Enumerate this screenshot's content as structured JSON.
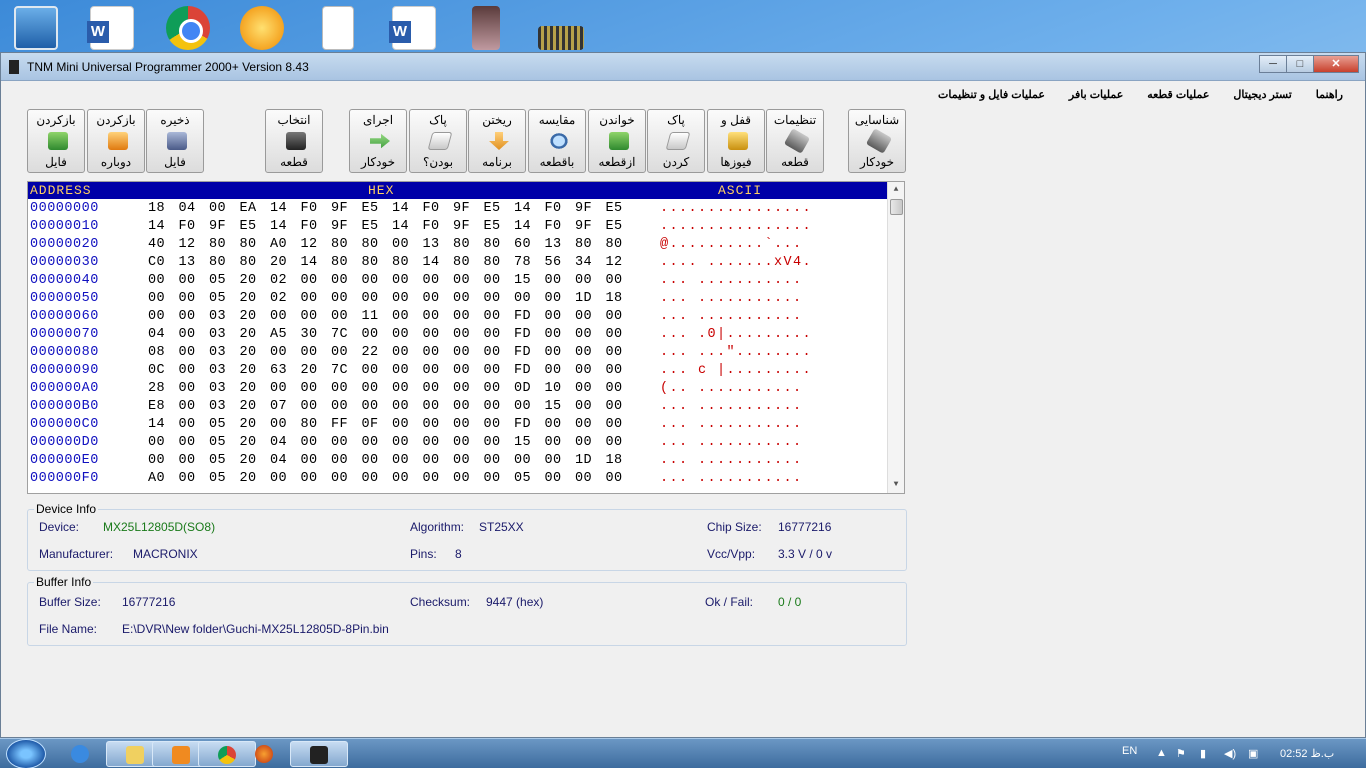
{
  "window": {
    "title": "TNM Mini Universal Programmer 2000+    Version 8.43",
    "controls": {
      "minimize": "─",
      "maximize": "□",
      "close": "✕"
    }
  },
  "menu": [
    "عملیات فایل و تنظیمات",
    "عملیات بافر",
    "عملیات قطعه",
    "تستر دیجیتال",
    "راهنما"
  ],
  "toolbar": {
    "reload_file": {
      "line1": "بازکردن",
      "line2": "فایل",
      "icon": "open-folder-icon"
    },
    "reopen": {
      "line1": "بازکردن",
      "line2": "دوباره",
      "icon": "reload-icon"
    },
    "save_file": {
      "line1": "ذخیره",
      "line2": "فایل",
      "icon": "save-disk-icon"
    },
    "select_chip": {
      "line1": "انتخاب",
      "line2": "قطعه",
      "icon": "chip-select-icon"
    },
    "auto_run": {
      "line1": "اجرای",
      "line2": "خودکار",
      "icon": "auto-arrow-icon"
    },
    "blank_check": {
      "line1": "پاک",
      "line2": "بودن؟",
      "icon": "eraser-icon"
    },
    "write": {
      "line1": "ریختن",
      "line2": "برنامه",
      "icon": "write-down-icon"
    },
    "verify": {
      "line1": "مقایسه",
      "line2": "باقطعه",
      "icon": "magnify-icon"
    },
    "read": {
      "line1": "خواندن",
      "line2": "ازقطعه",
      "icon": "read-chip-icon"
    },
    "erase": {
      "line1": "پاک",
      "line2": "کردن",
      "icon": "erase-icon"
    },
    "lock_fuses": {
      "line1": "قفل و",
      "line2": "فیوزها",
      "icon": "lock-icon"
    },
    "chip_settings": {
      "line1": "تنظیمات",
      "line2": "قطعه",
      "icon": "tools-icon"
    },
    "auto_detect": {
      "line1": "شناسایی",
      "line2": "خودکار",
      "icon": "auto-detect-icon"
    }
  },
  "hex": {
    "headers": {
      "address": "ADDRESS",
      "hex": "HEX",
      "ascii": "ASCII"
    },
    "rows": [
      {
        "addr": "00000000",
        "bytes": "18 04 00 EA 14 F0 9F E5 14 F0 9F E5 14 F0 9F E5",
        "ascii": "................"
      },
      {
        "addr": "00000010",
        "bytes": "14 F0 9F E5 14 F0 9F E5 14 F0 9F E5 14 F0 9F E5",
        "ascii": "................"
      },
      {
        "addr": "00000020",
        "bytes": "40 12 80 80 A0 12 80 80 00 13 80 80 60 13 80 80",
        "ascii": "@..........`..."
      },
      {
        "addr": "00000030",
        "bytes": "C0 13 80 80 20 14 80 80 80 14 80 80 78 56 34 12",
        "ascii": ".... .......xV4."
      },
      {
        "addr": "00000040",
        "bytes": "00 00 05 20 02 00 00 00 00 00 00 00 15 00 00 00",
        "ascii": "... ..........."
      },
      {
        "addr": "00000050",
        "bytes": "00 00 05 20 02 00 00 00 00 00 00 00 00 00 1D 18",
        "ascii": "... ..........."
      },
      {
        "addr": "00000060",
        "bytes": "00 00 03 20 00 00 00 11 00 00 00 00 FD 00 00 00",
        "ascii": "... ..........."
      },
      {
        "addr": "00000070",
        "bytes": "04 00 03 20 A5 30 7C 00 00 00 00 00 FD 00 00 00",
        "ascii": "... .0|........."
      },
      {
        "addr": "00000080",
        "bytes": "08 00 03 20 00 00 00 22 00 00 00 00 FD 00 00 00",
        "ascii": "... ...\"........"
      },
      {
        "addr": "00000090",
        "bytes": "0C 00 03 20 63 20 7C 00 00 00 00 00 FD 00 00 00",
        "ascii": "... c |........."
      },
      {
        "addr": "000000A0",
        "bytes": "28 00 03 20 00 00 00 00 00 00 00 00 0D 10 00 00",
        "ascii": "(.. ..........."
      },
      {
        "addr": "000000B0",
        "bytes": "E8 00 03 20 07 00 00 00 00 00 00 00 00 15 00 00",
        "ascii": "... ..........."
      },
      {
        "addr": "000000C0",
        "bytes": "14 00 05 20 00 80 FF 0F 00 00 00 00 FD 00 00 00",
        "ascii": "... ..........."
      },
      {
        "addr": "000000D0",
        "bytes": "00 00 05 20 04 00 00 00 00 00 00 00 15 00 00 00",
        "ascii": "... ..........."
      },
      {
        "addr": "000000E0",
        "bytes": "00 00 05 20 04 00 00 00 00 00 00 00 00 00 1D 18",
        "ascii": "... ..........."
      },
      {
        "addr": "000000F0",
        "bytes": "A0 00 05 20 00 00 00 00 00 00 00 00 05 00 00 00",
        "ascii": "... ..........."
      }
    ]
  },
  "device_info": {
    "title": "Device Info",
    "device_label": "Device:",
    "device_value": "MX25L12805D(SO8)",
    "manufacturer_label": "Manufacturer:",
    "manufacturer_value": "MACRONIX",
    "algorithm_label": "Algorithm:",
    "algorithm_value": "ST25XX",
    "pins_label": "Pins:",
    "pins_value": "8",
    "chip_size_label": "Chip Size:",
    "chip_size_value": "16777216",
    "vcc_label": "Vcc/Vpp:",
    "vcc_value": "3.3 V / 0 v"
  },
  "buffer_info": {
    "title": "Buffer Info",
    "buffer_size_label": "Buffer Size:",
    "buffer_size_value": "16777216",
    "checksum_label": "Checksum:",
    "checksum_value": "9447 (hex)",
    "okfail_label": "Ok / Fail:",
    "okfail_value": "0 / 0",
    "filename_label": "File Name:",
    "filename_value": "E:\\DVR\\New folder\\Guchi-MX25L12805D-8Pin.bin"
  },
  "taskbar": {
    "lang": "EN",
    "time": "02:52 ب.ظ",
    "items": [
      "ie-icon",
      "explorer-icon",
      "media-player-icon",
      "chrome-icon",
      "firefox-icon",
      "tnm-chip-icon"
    ]
  },
  "colors": {
    "hex_header_bg": "#0000a8",
    "hex_header_fg": "#ffd060",
    "ascii_fg": "#c80000",
    "address_fg": "#1010c0"
  }
}
